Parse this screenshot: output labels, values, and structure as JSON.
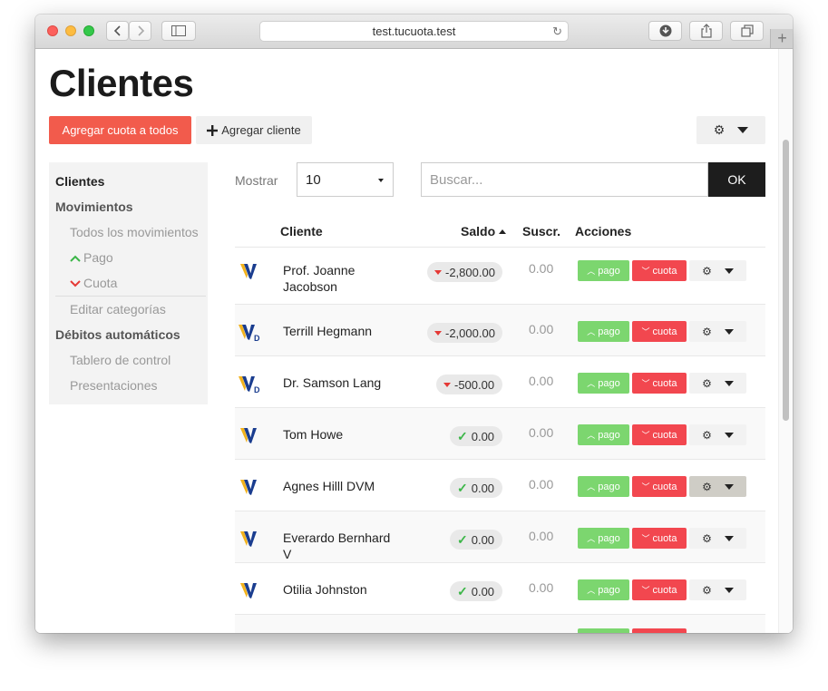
{
  "browser": {
    "url": "test.tucuota.test"
  },
  "page": {
    "title": "Clientes",
    "add_fee_all_label": "Agregar cuota a todos",
    "add_client_label": "Agregar cliente",
    "add_client_icon": "plus-icon",
    "settings_icon": "gear-icon"
  },
  "sidebar": {
    "items": [
      {
        "label": "Clientes",
        "kind": "header"
      },
      {
        "label": "Movimientos",
        "kind": "header"
      },
      {
        "label": "Todos los movimientos",
        "kind": "sub"
      },
      {
        "label": "Pago",
        "kind": "sub",
        "icon": "chevron-up-icon",
        "icon_color": "#3cb648"
      },
      {
        "label": "Cuota",
        "kind": "sub",
        "icon": "chevron-down-icon",
        "icon_color": "#e53935"
      },
      {
        "label": "Editar categorías",
        "kind": "sub"
      },
      {
        "label": "Débitos automáticos",
        "kind": "header"
      },
      {
        "label": "Tablero de control",
        "kind": "sub"
      },
      {
        "label": "Presentaciones",
        "kind": "sub"
      }
    ]
  },
  "controls": {
    "show_label": "Mostrar",
    "page_size": "10",
    "search_placeholder": "Buscar...",
    "search_button": "OK"
  },
  "table": {
    "columns": [
      "Cliente",
      "Saldo",
      "Suscr.",
      "Acciones"
    ],
    "sort_column": "Saldo",
    "sort_direction": "asc",
    "action_labels": {
      "pay": "pago",
      "fee": "cuota"
    },
    "rows": [
      {
        "logo": "V",
        "name": "Prof. Joanne Jacobson",
        "balance": "-2,800.00",
        "status": "negative",
        "subscriptions": "0.00"
      },
      {
        "logo": "VD",
        "name": "Terrill Hegmann",
        "balance": "-2,000.00",
        "status": "negative",
        "subscriptions": "0.00"
      },
      {
        "logo": "VD",
        "name": "Dr. Samson Lang",
        "balance": "-500.00",
        "status": "negative",
        "subscriptions": "0.00"
      },
      {
        "logo": "V",
        "name": "Tom Howe",
        "balance": "0.00",
        "status": "ok",
        "subscriptions": "0.00"
      },
      {
        "logo": "V",
        "name": "Agnes Hilll DVM",
        "balance": "0.00",
        "status": "ok",
        "subscriptions": "0.00"
      },
      {
        "logo": "V",
        "name": "Everardo Bernhard V",
        "balance": "0.00",
        "status": "ok",
        "subscriptions": "0.00"
      },
      {
        "logo": "V",
        "name": "Otilia Johnston",
        "balance": "0.00",
        "status": "ok",
        "subscriptions": "0.00"
      }
    ]
  },
  "colors": {
    "primary_red": "#f25b4c",
    "pay_green": "#7cd66f",
    "fee_red": "#f2474f",
    "logo_blue": "#1a3d8f",
    "logo_gold": "#f2b21c"
  }
}
